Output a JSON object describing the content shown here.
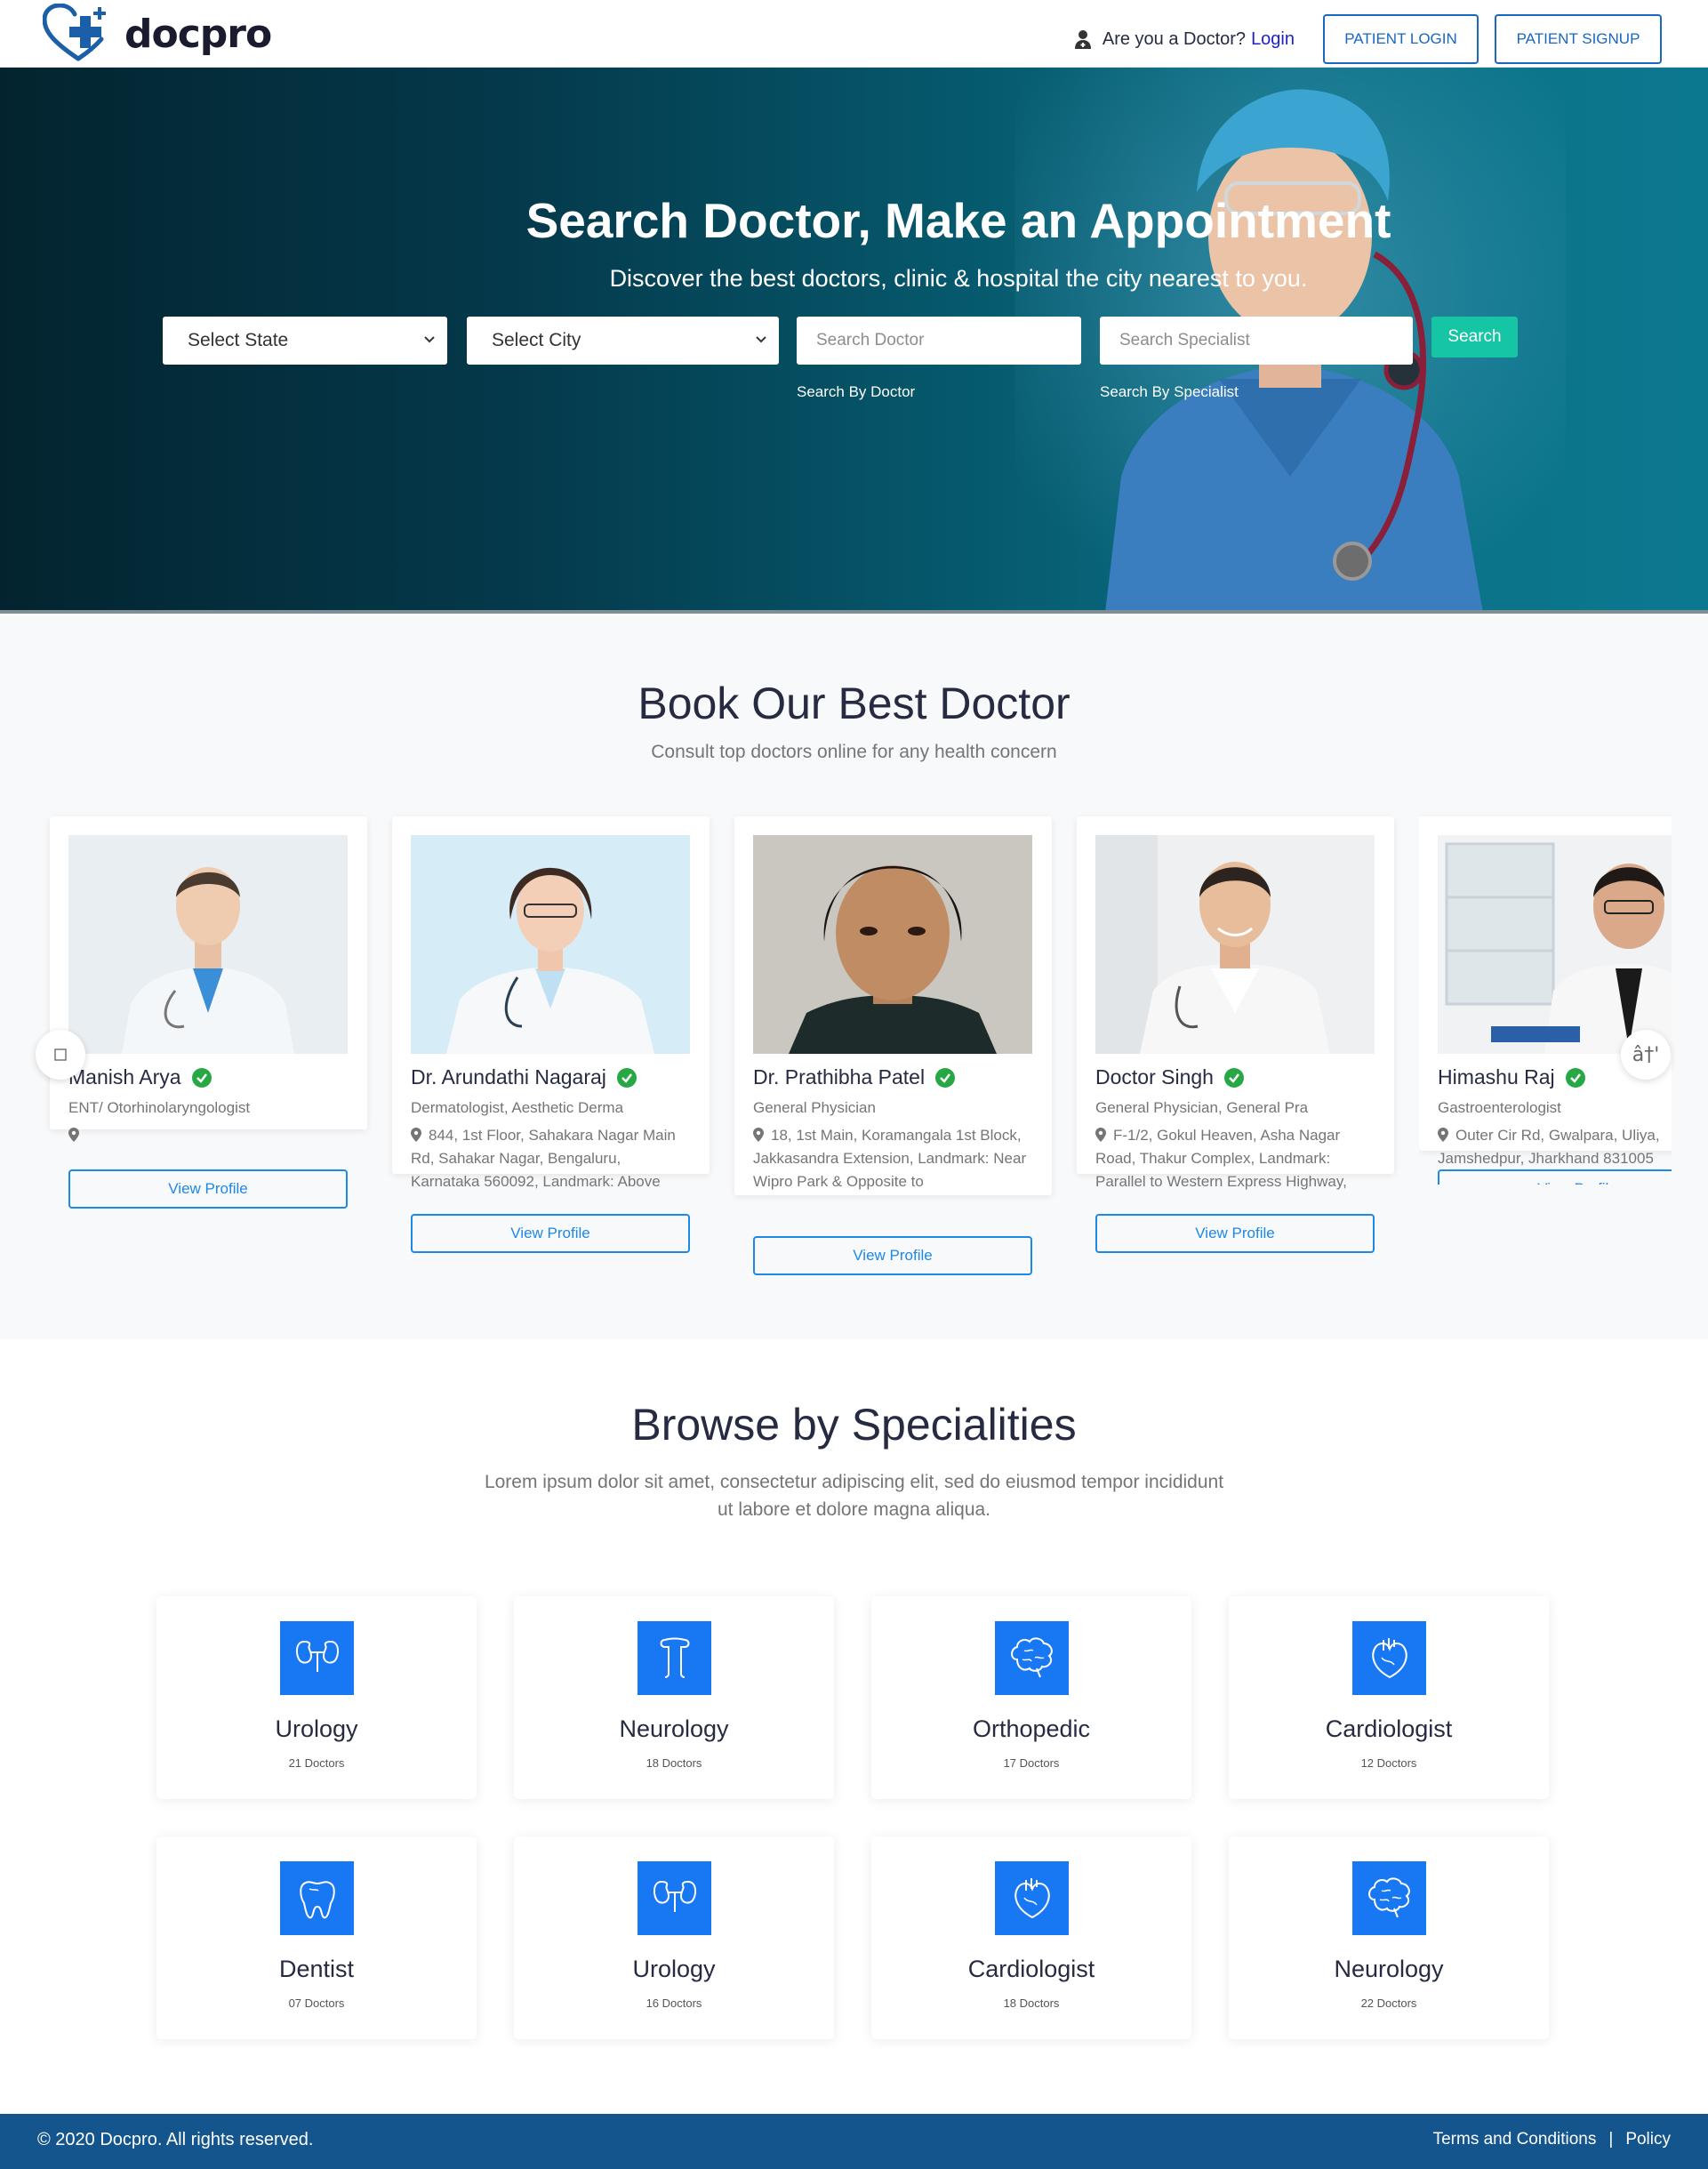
{
  "header": {
    "logo_text": "docpro",
    "doctor_question": "Are you a Doctor?",
    "doctor_login": "Login",
    "patient_login": "PATIENT LOGIN",
    "patient_signup": "PATIENT SIGNUP"
  },
  "hero": {
    "title": "Search Doctor, Make an Appointment",
    "subtitle": "Discover the best doctors, clinic & hospital the city nearest to you.",
    "state_select": "Select State",
    "city_select": "Select City",
    "doctor_placeholder": "Search Doctor",
    "specialist_placeholder": "Search Specialist",
    "search_button": "Search",
    "hint_doctor": "Search By Doctor",
    "hint_specialist": "Search By Specialist"
  },
  "best_doctors": {
    "title": "Book Our Best Doctor",
    "subtitle": "Consult top doctors online for any health concern",
    "view_profile": "View Profile",
    "doctors": [
      {
        "name": "Manish Arya",
        "specialty": "ENT/ Otorhinolaryngologist",
        "address": ""
      },
      {
        "name": "Dr. Arundathi Nagaraj",
        "specialty": "Dermatologist, Aesthetic Derma",
        "address": "844, 1st Floor, Sahakara Nagar Main Rd, Sahakar Nagar, Bengaluru, Karnataka 560092, Landmark: Above"
      },
      {
        "name": "Dr. Prathibha Patel",
        "specialty": "General Physician",
        "address": "18, 1st Main, Koramangala 1st Block, Jakkasandra Extension, Landmark: Near Wipro Park & Opposite to"
      },
      {
        "name": "Doctor Singh",
        "specialty": "General Physician, General Pra",
        "address": "F-1/2, Gokul Heaven, Asha Nagar Road, Thakur Complex, Landmark: Parallel to Western Express Highway,"
      },
      {
        "name": "Himashu Raj",
        "specialty": "Gastroenterologist",
        "address": "Outer Cir Rd, Gwalpara, Uliya, Jamshedpur, Jharkhand 831005"
      }
    ],
    "prev_arrow": "",
    "next_arrow": "â†'"
  },
  "specialities": {
    "title": "Browse by Specialities",
    "description": "Lorem ipsum dolor sit amet, consectetur adipiscing elit, sed do eiusmod tempor incididunt ut labore et dolore magna aliqua.",
    "items": [
      {
        "name": "Urology",
        "count": "21 Doctors",
        "icon": "kidney-icon"
      },
      {
        "name": "Neurology",
        "count": "18 Doctors",
        "icon": "bone-icon"
      },
      {
        "name": "Orthopedic",
        "count": "17 Doctors",
        "icon": "brain-icon"
      },
      {
        "name": "Cardiologist",
        "count": "12 Doctors",
        "icon": "heart-icon"
      },
      {
        "name": "Dentist",
        "count": "07 Doctors",
        "icon": "tooth-icon"
      },
      {
        "name": "Urology",
        "count": "16 Doctors",
        "icon": "kidney-icon"
      },
      {
        "name": "Cardiologist",
        "count": "18 Doctors",
        "icon": "heart-icon"
      },
      {
        "name": "Neurology",
        "count": "22 Doctors",
        "icon": "brain-icon"
      }
    ]
  },
  "footer": {
    "copyright": "© 2020 Docpro. All rights reserved.",
    "terms": "Terms and Conditions",
    "separator": "|",
    "policy": "Policy"
  },
  "colors": {
    "brand_blue": "#1877f2",
    "accent_green": "#16c5a3",
    "footer_blue": "#15558d",
    "verified_green": "#28a745"
  }
}
